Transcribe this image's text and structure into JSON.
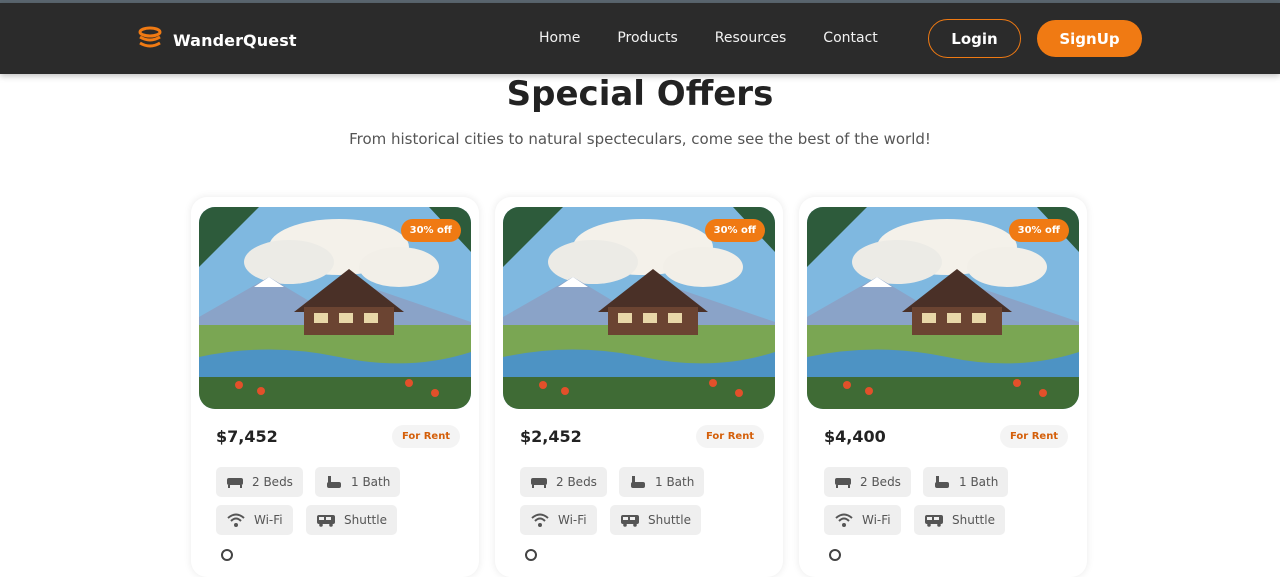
{
  "brand": {
    "name": "WanderQuest",
    "logo_icon": "layers-logo-icon",
    "accent": "#f07a13"
  },
  "nav": {
    "links": [
      "Home",
      "Products",
      "Resources",
      "Contact"
    ],
    "login_label": "Login",
    "signup_label": "SignUp"
  },
  "section": {
    "title": "Special Offers",
    "subtitle": "From historical cities to natural specteculars, come see the best of the world!"
  },
  "cards": [
    {
      "discount": "30% off",
      "price": "$7,452",
      "tag": "For Rent",
      "beds": "2 Beds",
      "bath": "1 Bath",
      "wifi": "Wi-Fi",
      "shuttle": "Shuttle"
    },
    {
      "discount": "30% off",
      "price": "$2,452",
      "tag": "For Rent",
      "beds": "2 Beds",
      "bath": "1 Bath",
      "wifi": "Wi-Fi",
      "shuttle": "Shuttle"
    },
    {
      "discount": "30% off",
      "price": "$4,400",
      "tag": "For Rent",
      "beds": "2 Beds",
      "bath": "1 Bath",
      "wifi": "Wi-Fi",
      "shuttle": "Shuttle"
    }
  ]
}
